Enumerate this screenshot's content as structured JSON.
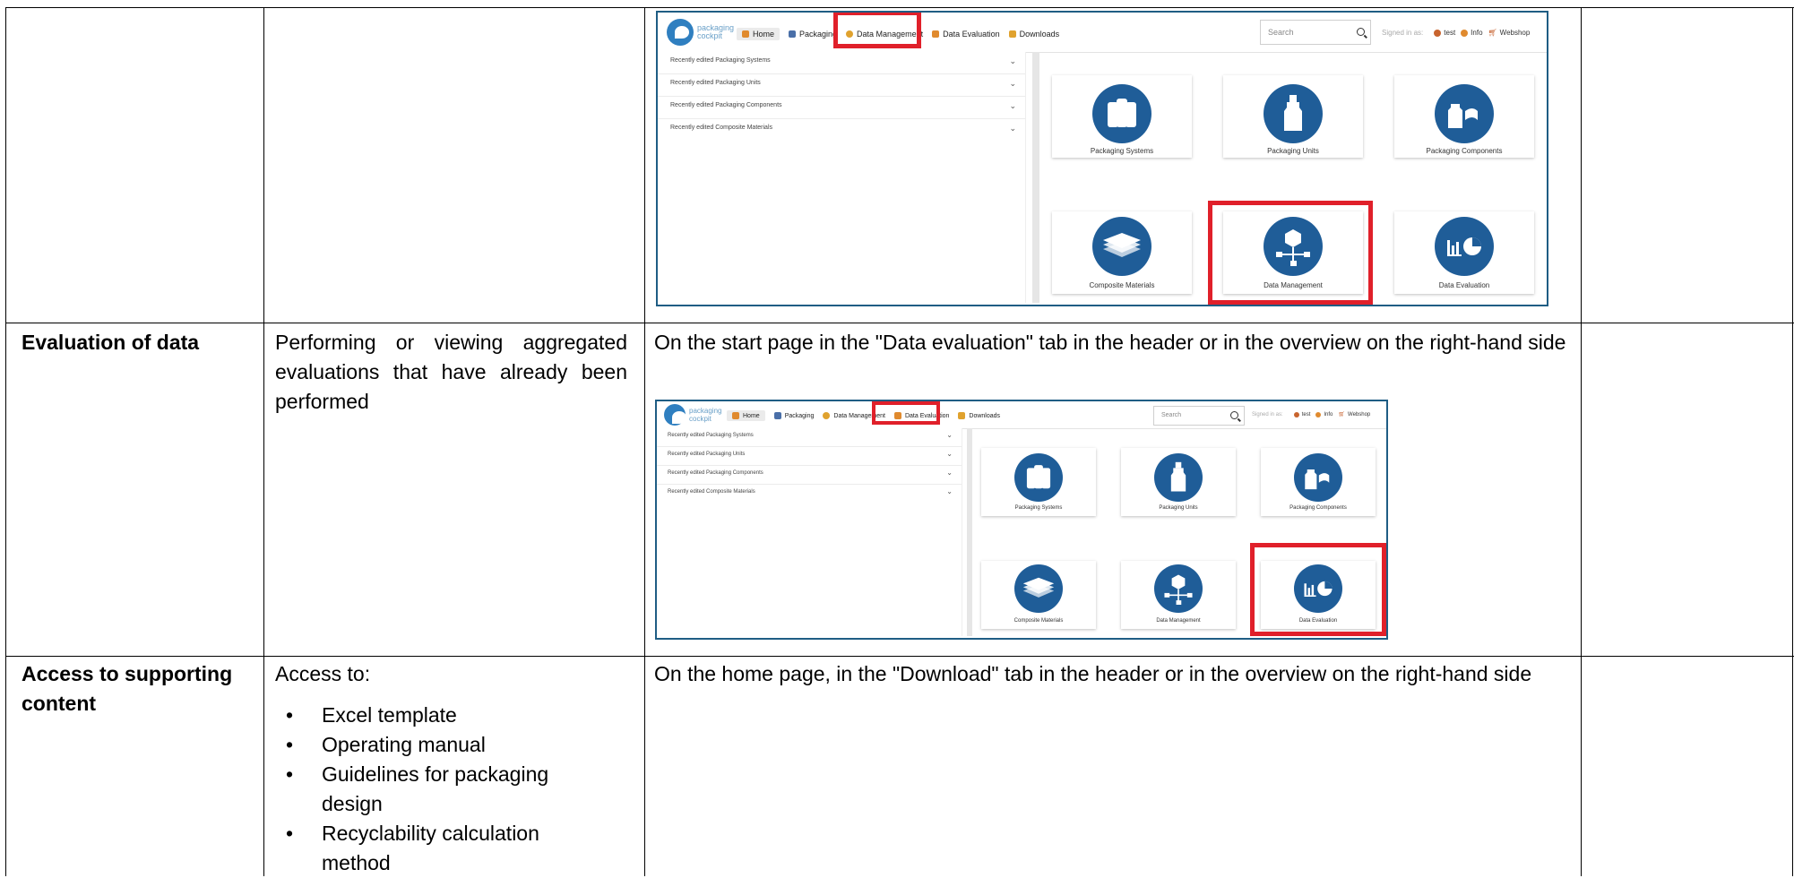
{
  "table": {
    "rows": [
      {
        "col1": "",
        "col2": ""
      },
      {
        "col1": "Evaluation of data",
        "col2": "Performing or viewing aggregated evaluations that have already been performed",
        "col3": "On the start page in the \"Data evaluation\" tab in the header or in the overview on the right-hand side"
      },
      {
        "col1": "Access to supporting content",
        "col2_intro": "Access to:",
        "col2_bullets": [
          "Excel template",
          "Operating manual",
          "Guidelines for packaging design",
          "Recyclability calculation method"
        ],
        "col3": "On the home page, in the \"Download\" tab in the header or in the overview on the right-hand side"
      }
    ]
  },
  "app": {
    "logo_text": "packaging cockpit",
    "nav": [
      "Home",
      "Packaging",
      "Data Management",
      "Data Evaluation",
      "Downloads"
    ],
    "search_placeholder": "Search",
    "signed_in_label": "Signed in as:",
    "user": "test",
    "info": "Info",
    "webshop": "Webshop",
    "recent_items": [
      "Recently edited Packaging Systems",
      "Recently edited Packaging Units",
      "Recently edited Packaging Components",
      "Recently edited Composite Materials"
    ],
    "tiles": [
      {
        "label": "Packaging Systems",
        "icon": "packaging-systems-icon"
      },
      {
        "label": "Packaging Units",
        "icon": "bottle-icon"
      },
      {
        "label": "Packaging Components",
        "icon": "components-icon"
      },
      {
        "label": "Composite Materials",
        "icon": "layers-icon"
      },
      {
        "label": "Data Management",
        "icon": "network-cube-icon"
      },
      {
        "label": "Data Evaluation",
        "icon": "chart-icon"
      }
    ],
    "highlight_colors": {
      "brand": "#1f5d98",
      "highlight": "#e0202a",
      "accent": "#e08a2e"
    }
  }
}
